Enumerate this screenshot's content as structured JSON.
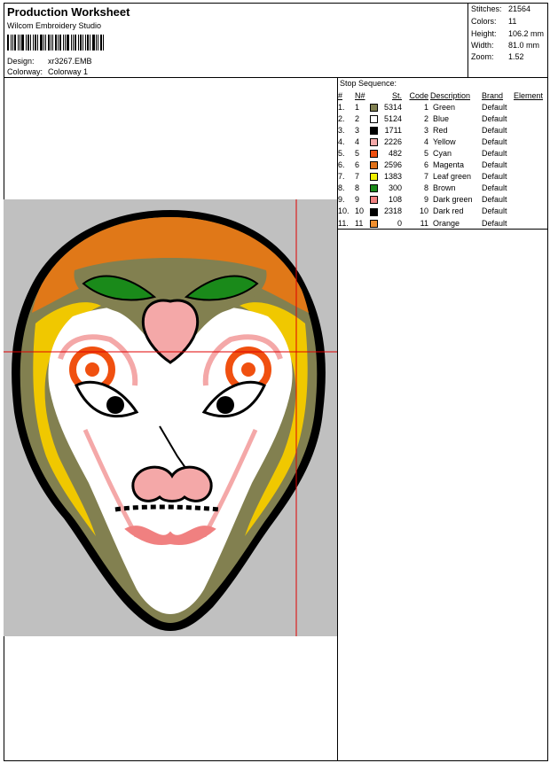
{
  "header": {
    "title": "Production Worksheet",
    "software": "Wilcom Embroidery Studio",
    "design_label": "Design:",
    "design_value": "xr3267.EMB",
    "colorway_label": "Colorway:",
    "colorway_value": "Colorway 1"
  },
  "stats": [
    {
      "label": "Stitches:",
      "value": "21564"
    },
    {
      "label": "Colors:",
      "value": "11"
    },
    {
      "label": "Height:",
      "value": "106.2 mm"
    },
    {
      "label": "Width:",
      "value": "81.0 mm"
    },
    {
      "label": "Zoom:",
      "value": "1.52"
    }
  ],
  "stop_sequence": {
    "title": "Stop Sequence:",
    "columns": [
      "#",
      "N#",
      "St.",
      "Code",
      "Description",
      "Brand",
      "Element"
    ],
    "rows": [
      {
        "num": "1.",
        "n": "1",
        "st": "5314",
        "code": "1",
        "desc": "Green",
        "brand": "Default",
        "color": "#808050"
      },
      {
        "num": "2.",
        "n": "2",
        "st": "5124",
        "code": "2",
        "desc": "Blue",
        "brand": "Default",
        "color": "#ffffff"
      },
      {
        "num": "3.",
        "n": "3",
        "st": "1711",
        "code": "3",
        "desc": "Red",
        "brand": "Default",
        "color": "#000000"
      },
      {
        "num": "4.",
        "n": "4",
        "st": "2226",
        "code": "4",
        "desc": "Yellow",
        "brand": "Default",
        "color": "#f4a8a8"
      },
      {
        "num": "5.",
        "n": "5",
        "st": "482",
        "code": "5",
        "desc": "Cyan",
        "brand": "Default",
        "color": "#f05010"
      },
      {
        "num": "6.",
        "n": "6",
        "st": "2596",
        "code": "6",
        "desc": "Magenta",
        "brand": "Default",
        "color": "#e07018"
      },
      {
        "num": "7.",
        "n": "7",
        "st": "1383",
        "code": "7",
        "desc": "Leaf green",
        "brand": "Default",
        "color": "#f0f000"
      },
      {
        "num": "8.",
        "n": "8",
        "st": "300",
        "code": "8",
        "desc": "Brown",
        "brand": "Default",
        "color": "#1a8a1a"
      },
      {
        "num": "9.",
        "n": "9",
        "st": "108",
        "code": "9",
        "desc": "Dark green",
        "brand": "Default",
        "color": "#f08080"
      },
      {
        "num": "10.",
        "n": "10",
        "st": "2318",
        "code": "10",
        "desc": "Dark red",
        "brand": "Default",
        "color": "#000000"
      },
      {
        "num": "11.",
        "n": "11",
        "st": "0",
        "code": "11",
        "desc": "Orange",
        "brand": "Default",
        "color": "#f09030"
      }
    ]
  },
  "preview": {
    "background": "#c0c0c0",
    "guide_color": "#e00000"
  }
}
